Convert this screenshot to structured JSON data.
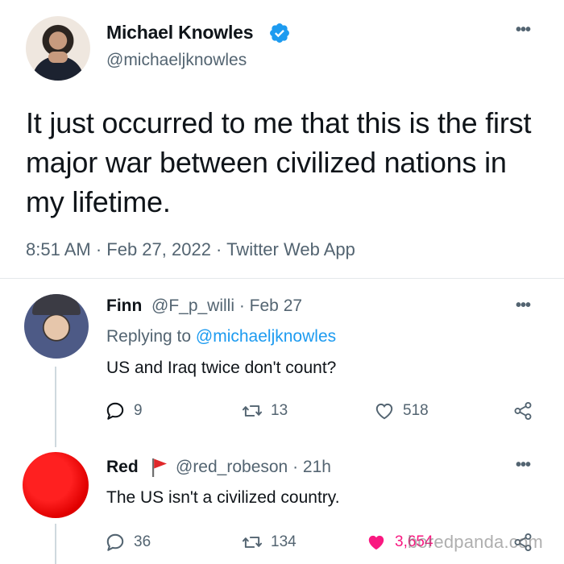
{
  "main_tweet": {
    "name": "Michael Knowles",
    "handle": "@michaeljknowles",
    "text": "It just occurred to me that this is the first major war between civilized nations in my lifetime.",
    "meta": "8:51 AM · Feb 27, 2022 · Twitter Web App",
    "more_label": "•••",
    "verified_icon": "verified-badge-icon"
  },
  "replies": [
    {
      "name": "Finn",
      "handle_time": "@F_p_willi · Feb 27",
      "replying_prefix": "Replying to ",
      "replying_to": "@michaeljknowles",
      "text": "US and Iraq twice don't count?",
      "more_label": "•••",
      "comments": "9",
      "retweets": "13",
      "likes": "518"
    },
    {
      "name": "Red",
      "handle_time": "@red_robeson · 21h",
      "text": "The US isn't a civilized country.",
      "more_label": "•••",
      "comments": "36",
      "retweets": "134",
      "likes": "3,654",
      "liked": true
    }
  ],
  "watermark": "boredpanda.com",
  "colors": {
    "verified": "#1d9bf0",
    "mention": "#1d9bf0",
    "like_active": "#f91880",
    "red_avatar": "#ee0000",
    "flag": "#e0282b"
  }
}
